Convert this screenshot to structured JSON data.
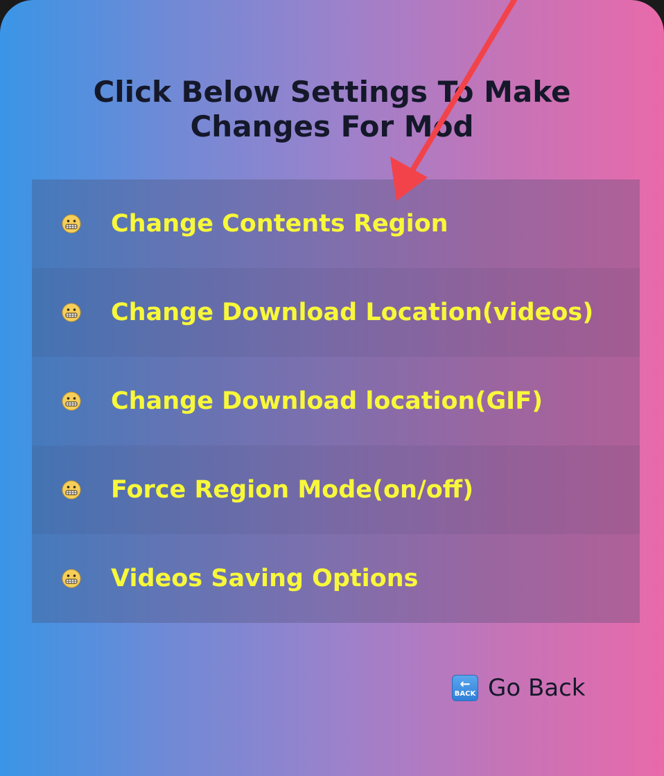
{
  "dialog": {
    "title_line1": "Click Below Settings To Make",
    "title_line2": "Changes For Mod"
  },
  "menu": {
    "items": [
      {
        "icon": "grimacing-face-icon",
        "label": "Change Contents Region"
      },
      {
        "icon": "grimacing-face-icon",
        "label": "Change Download Location(videos)"
      },
      {
        "icon": "grimacing-face-icon",
        "label": "Change Download location(GIF)"
      },
      {
        "icon": "grimacing-face-icon",
        "label": "Force Region Mode(on/off)"
      },
      {
        "icon": "grimacing-face-icon",
        "label": "Videos Saving Options"
      }
    ]
  },
  "footer": {
    "back_icon": "back-arrow-icon",
    "back_icon_text": "BACK",
    "back_label": "Go Back"
  },
  "annotation": {
    "type": "red-arrow",
    "color": "#f2434a"
  },
  "colors": {
    "item_text": "#f8f83a",
    "title_text": "#14182a"
  }
}
